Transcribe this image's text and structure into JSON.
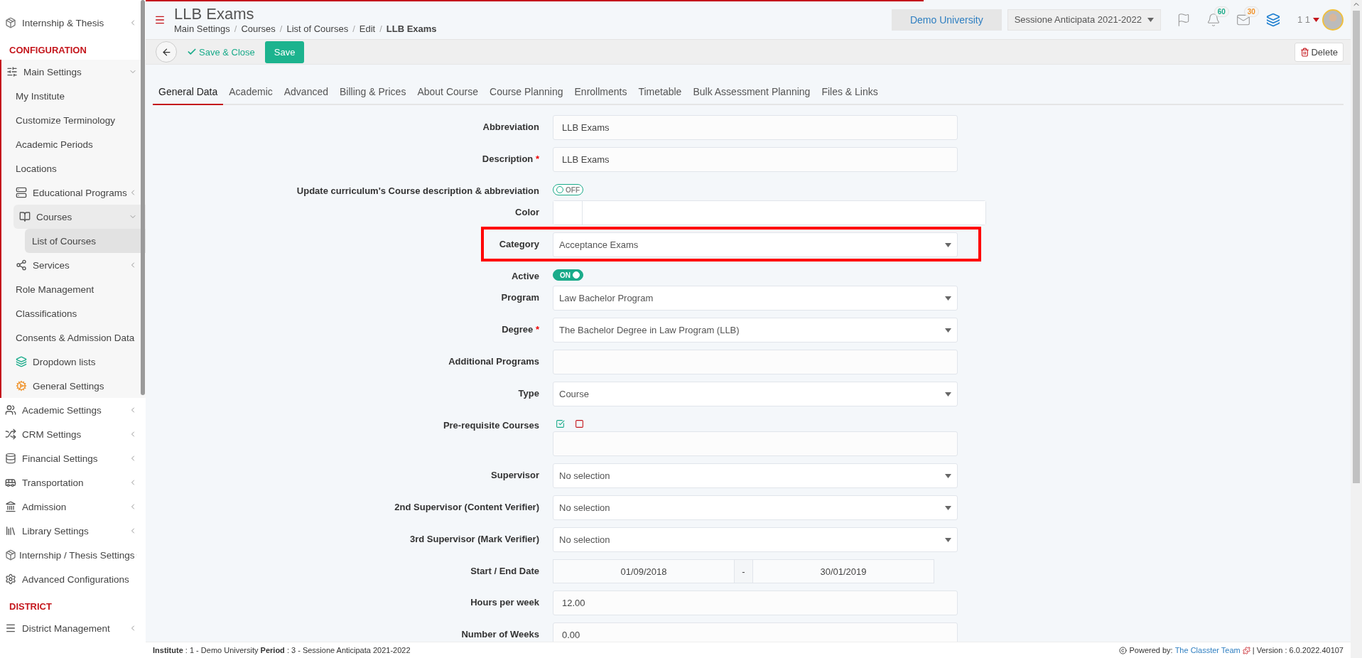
{
  "sidebar": {
    "groups": [
      {
        "items": [
          {
            "label": "Internship & Thesis",
            "selected": false,
            "expanded": false
          }
        ]
      },
      {
        "heading": "CONFIGURATION",
        "items": [
          {
            "label": "Main Settings",
            "selected": false,
            "expanded": true,
            "children": [
              {
                "label": "My Institute",
                "selected": false
              },
              {
                "label": "Customize Terminology",
                "selected": false
              },
              {
                "label": "Academic Periods",
                "selected": false
              },
              {
                "label": "Locations",
                "selected": false
              },
              {
                "label": "Educational Programs",
                "selected": false,
                "expanded": false
              },
              {
                "label": "Courses",
                "selected": true,
                "expanded": true,
                "children": [
                  {
                    "label": "List of Courses",
                    "selected": true
                  }
                ]
              },
              {
                "label": "Services",
                "selected": false,
                "expanded": false
              },
              {
                "label": "Role Management",
                "selected": false
              },
              {
                "label": "Classifications",
                "selected": false
              },
              {
                "label": "Consents & Admission Data",
                "selected": false
              },
              {
                "label": "Dropdown lists",
                "selected": false
              },
              {
                "label": "General Settings",
                "selected": false
              }
            ]
          },
          {
            "label": "Academic Settings",
            "selected": false,
            "expanded": false
          },
          {
            "label": "CRM Settings",
            "selected": false,
            "expanded": false
          },
          {
            "label": "Financial Settings",
            "selected": false,
            "expanded": false
          },
          {
            "label": "Transportation",
            "selected": false,
            "expanded": false
          },
          {
            "label": "Admission",
            "selected": false,
            "expanded": false
          },
          {
            "label": "Library Settings",
            "selected": false,
            "expanded": false
          },
          {
            "label": "Internship / Thesis Settings",
            "selected": false,
            "expanded": false
          },
          {
            "label": "Advanced Configurations",
            "selected": false
          }
        ]
      },
      {
        "heading": "DISTRICT",
        "items": [
          {
            "label": "District Management",
            "selected": false,
            "expanded": false
          }
        ]
      }
    ]
  },
  "header": {
    "title": "LLB Exams",
    "separator": "/",
    "breadcrumb": [
      {
        "label": "Main Settings",
        "current": false
      },
      {
        "label": "Courses",
        "current": false
      },
      {
        "label": "List of Courses",
        "current": false
      },
      {
        "label": "Edit",
        "current": false
      },
      {
        "label": "LLB Exams",
        "current": true
      }
    ],
    "institute_button": "Demo University",
    "period_select": "Sessione Anticipata 2021-2022",
    "notifications": "60",
    "messages": "30",
    "user_counter": "1 1"
  },
  "toolbar": {
    "save_close": "Save & Close",
    "save": "Save",
    "delete": "Delete"
  },
  "tabs": [
    {
      "label": "General Data",
      "selected": true
    },
    {
      "label": "Academic",
      "selected": false
    },
    {
      "label": "Advanced",
      "selected": false
    },
    {
      "label": "Billing & Prices",
      "selected": false
    },
    {
      "label": "About Course",
      "selected": false
    },
    {
      "label": "Course Planning",
      "selected": false
    },
    {
      "label": "Enrollments",
      "selected": false
    },
    {
      "label": "Timetable",
      "selected": false
    },
    {
      "label": "Bulk Assessment Planning",
      "selected": false
    },
    {
      "label": "Files & Links",
      "selected": false
    }
  ],
  "form": {
    "fields": [
      {
        "kind": "text",
        "label": "Abbreviation",
        "value": "LLB Exams"
      },
      {
        "kind": "text",
        "label": "Description",
        "required_mark": "*",
        "value": "LLB Exams"
      },
      {
        "kind": "toggle",
        "label": "Update curriculum's Course description & abbreviation",
        "on": false,
        "state_text": "OFF"
      },
      {
        "kind": "color",
        "label": "Color"
      },
      {
        "kind": "select",
        "label": "Category",
        "value": "Acceptance Exams",
        "highlighted": true
      },
      {
        "kind": "toggle",
        "label": "Active",
        "on": true,
        "state_text": "ON"
      },
      {
        "kind": "select",
        "label": "Program",
        "value": "Law Bachelor Program"
      },
      {
        "kind": "select",
        "label": "Degree",
        "required_mark": "*",
        "value": "The Bachelor Degree in Law Program (LLB)"
      },
      {
        "kind": "text",
        "label": "Additional Programs"
      },
      {
        "kind": "select",
        "label": "Type",
        "value": "Course"
      },
      {
        "kind": "checklist",
        "label": "Pre-requisite Courses"
      },
      {
        "kind": "select",
        "label": "Supervisor",
        "value": "No selection"
      },
      {
        "kind": "select",
        "label": "2nd Supervisor (Content Verifier)",
        "value": "No selection"
      },
      {
        "kind": "select",
        "label": "3rd Supervisor (Mark Verifier)",
        "value": "No selection"
      },
      {
        "kind": "daterange",
        "label": "Start / End Date",
        "start": "01/09/2018",
        "separator": "-",
        "end": "30/01/2019"
      },
      {
        "kind": "text",
        "label": "Hours per week",
        "value": "12.00"
      },
      {
        "kind": "text",
        "label": "Number of Weeks",
        "value": "0.00"
      }
    ]
  },
  "footer": {
    "context": "**Institute** : 1 - Demo University **Period** : 3 - Sessione Anticipata 2021-2022",
    "powered_by": "Powered by:",
    "team_link": "The Classter Team",
    "version": "| Version : 6.0.2022.40107"
  }
}
